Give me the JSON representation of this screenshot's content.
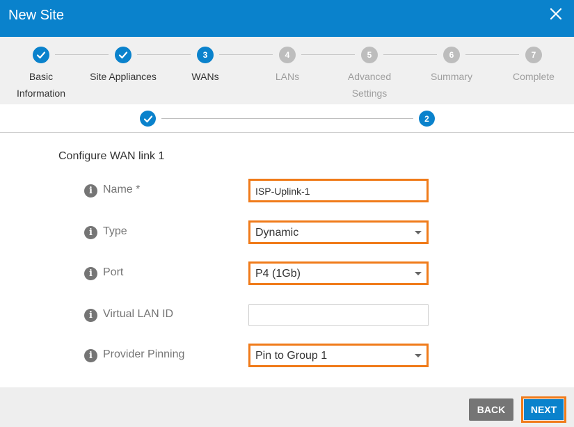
{
  "dialog": {
    "title": "New Site"
  },
  "steps": [
    {
      "number": "1",
      "label_line1": "Basic",
      "label_line2": "Information",
      "state": "done"
    },
    {
      "number": "2",
      "label_line1": "Site Appliances",
      "label_line2": "",
      "state": "done"
    },
    {
      "number": "3",
      "label_line1": "WANs",
      "label_line2": "",
      "state": "active"
    },
    {
      "number": "4",
      "label_line1": "LANs",
      "label_line2": "",
      "state": "pending"
    },
    {
      "number": "5",
      "label_line1": "Advanced",
      "label_line2": "Settings",
      "state": "pending"
    },
    {
      "number": "6",
      "label_line1": "Summary",
      "label_line2": "",
      "state": "pending"
    },
    {
      "number": "7",
      "label_line1": "Complete",
      "label_line2": "",
      "state": "pending"
    }
  ],
  "substeps": [
    {
      "number": "1",
      "state": "done"
    },
    {
      "number": "2",
      "state": "active"
    }
  ],
  "form": {
    "section_title": "Configure WAN link 1",
    "name": {
      "label": "Name *",
      "value": "ISP-Uplink-1"
    },
    "type": {
      "label": "Type",
      "value": "Dynamic"
    },
    "port": {
      "label": "Port",
      "value": "P4 (1Gb)"
    },
    "vlan": {
      "label": "Virtual LAN ID",
      "value": ""
    },
    "provider_pinning": {
      "label": "Provider Pinning",
      "value": "Pin to Group 1"
    }
  },
  "buttons": {
    "back": "BACK",
    "next": "NEXT"
  },
  "colors": {
    "primary": "#0a82cc",
    "highlight": "#f07b1a",
    "pending": "#bdbdbd",
    "back_button": "#757575"
  },
  "icons": {
    "close": "close-icon",
    "check": "check-icon",
    "info": "info-icon",
    "dropdown": "chevron-down-icon"
  }
}
